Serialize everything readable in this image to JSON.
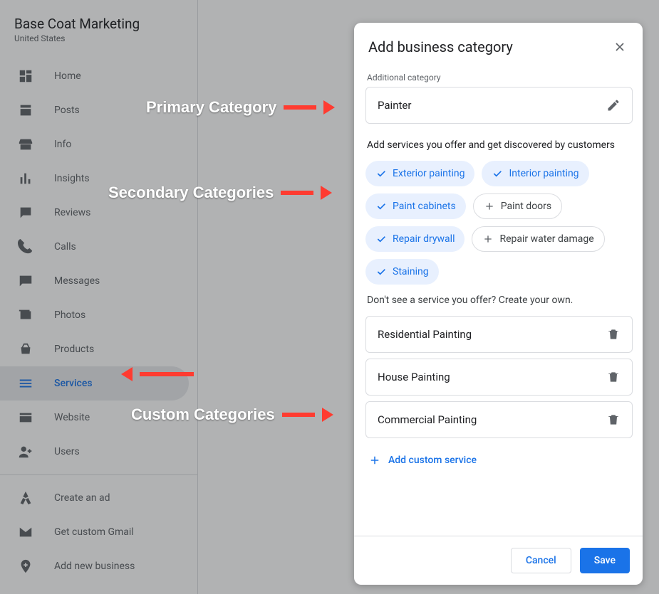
{
  "business": {
    "name": "Base Coat Marketing",
    "location": "United States"
  },
  "sidebar": {
    "items": [
      {
        "label": "Home",
        "icon": "dashboard-icon"
      },
      {
        "label": "Posts",
        "icon": "post-icon"
      },
      {
        "label": "Info",
        "icon": "storefront-icon"
      },
      {
        "label": "Insights",
        "icon": "insights-icon"
      },
      {
        "label": "Reviews",
        "icon": "reviews-icon"
      },
      {
        "label": "Calls",
        "icon": "phone-icon"
      },
      {
        "label": "Messages",
        "icon": "messages-icon"
      },
      {
        "label": "Photos",
        "icon": "photos-icon"
      },
      {
        "label": "Products",
        "icon": "basket-icon"
      },
      {
        "label": "Services",
        "icon": "services-icon",
        "selected": true
      },
      {
        "label": "Website",
        "icon": "website-icon"
      },
      {
        "label": "Users",
        "icon": "users-icon"
      }
    ],
    "footer": [
      {
        "label": "Create an ad",
        "icon": "ads-icon"
      },
      {
        "label": "Get custom Gmail",
        "icon": "gmail-icon"
      },
      {
        "label": "Add new business",
        "icon": "add-location-icon"
      }
    ]
  },
  "modal": {
    "title": "Add business category",
    "field_label": "Additional category",
    "category_value": "Painter",
    "services_helper": "Add services you offer and get discovered by customers",
    "services": [
      {
        "label": "Exterior painting",
        "selected": true
      },
      {
        "label": "Interior painting",
        "selected": true
      },
      {
        "label": "Paint cabinets",
        "selected": true
      },
      {
        "label": "Paint doors",
        "selected": false
      },
      {
        "label": "Repair drywall",
        "selected": true
      },
      {
        "label": "Repair water damage",
        "selected": false
      },
      {
        "label": "Staining",
        "selected": true
      }
    ],
    "custom_hint": "Don't see a service you offer? Create your own.",
    "custom_services": [
      "Residential Painting",
      "House Painting",
      "Commercial Painting"
    ],
    "add_custom_label": "Add custom service",
    "cancel_label": "Cancel",
    "save_label": "Save"
  },
  "annotations": {
    "primary": "Primary Category",
    "secondary": "Secondary Categories",
    "custom": "Custom Categories"
  },
  "colors": {
    "accent_blue": "#1a73e8",
    "arrow_red": "#ff3b30"
  }
}
